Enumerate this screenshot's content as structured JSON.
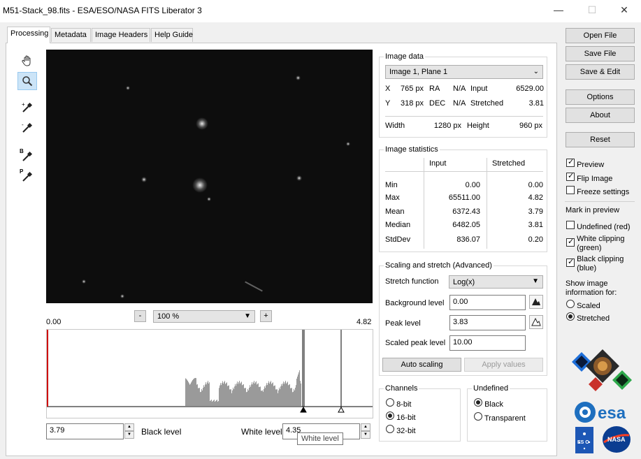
{
  "window": {
    "title": "M51-Stack_98.fits - ESA/ESO/NASA FITS Liberator 3",
    "minimize": "—",
    "maximize": "☐",
    "close": "✕"
  },
  "tabs": [
    "Processing",
    "Metadata",
    "Image Headers",
    "Help Guide"
  ],
  "tools": {
    "hand": "hand-tool",
    "zoom": "zoom-tool",
    "picker_plus": "picker-add-tool",
    "picker_minus": "picker-remove-tool",
    "black_picker_letter": "B",
    "peak_picker_letter": "P"
  },
  "viewer": {
    "zoom_minus": "-",
    "zoom_value": "100 %",
    "zoom_plus": "+",
    "hist_min": "0.00",
    "hist_max": "4.82"
  },
  "levels": {
    "black_value": "3.79",
    "black_label": "Black level",
    "white_label": "White level",
    "white_value": "4.35",
    "tooltip": "White level"
  },
  "image_data": {
    "title": "Image data",
    "plane": "Image 1, Plane 1",
    "x_label": "X",
    "x_value": "765 px",
    "ra_label": "RA",
    "ra_value": "N/A",
    "input_label": "Input",
    "input_value": "6529.00",
    "y_label": "Y",
    "y_value": "318 px",
    "dec_label": "DEC",
    "dec_value": "N/A",
    "stretched_label": "Stretched",
    "stretched_value": "3.81",
    "width_label": "Width",
    "width_value": "1280 px",
    "height_label": "Height",
    "height_value": "960 px"
  },
  "stats": {
    "title": "Image statistics",
    "col_input": "Input",
    "col_stretched": "Stretched",
    "rows": [
      {
        "label": "Min",
        "input": "0.00",
        "stretched": "0.00"
      },
      {
        "label": "Max",
        "input": "65511.00",
        "stretched": "4.82"
      },
      {
        "label": "Mean",
        "input": "6372.43",
        "stretched": "3.79"
      },
      {
        "label": "Median",
        "input": "6482.05",
        "stretched": "3.81"
      },
      {
        "label": "StdDev",
        "input": "836.07",
        "stretched": "0.20"
      }
    ]
  },
  "scaling": {
    "title": "Scaling and stretch (Advanced)",
    "stretch_label": "Stretch function",
    "stretch_value": "Log(x)",
    "background_label": "Background level",
    "background_value": "0.00",
    "peak_label": "Peak level",
    "peak_value": "3.83",
    "scaled_peak_label": "Scaled peak level",
    "scaled_peak_value": "10.00",
    "auto_btn": "Auto scaling",
    "apply_btn": "Apply values"
  },
  "channels": {
    "title": "Channels",
    "options": [
      "8-bit",
      "16-bit",
      "32-bit"
    ],
    "selected": "16-bit"
  },
  "undefined": {
    "title": "Undefined",
    "options": [
      "Black",
      "Transparent"
    ],
    "selected": "Black"
  },
  "sidebar": {
    "open_file": "Open File",
    "save_file": "Save File",
    "save_edit": "Save & Edit",
    "options": "Options",
    "about": "About",
    "reset": "Reset",
    "preview": "Preview",
    "flip": "Flip Image",
    "freeze": "Freeze settings",
    "mark_title": "Mark in preview",
    "undefined_red": "Undefined (red)",
    "white_clip_1": "White clipping",
    "white_clip_2": "(green)",
    "black_clip_1": "Black clipping",
    "black_clip_2": "(blue)",
    "show_info_1": "Show image",
    "show_info_2": "information for:",
    "scaled": "Scaled",
    "stretched": "Stretched",
    "esa_text": "esa",
    "eso_text": "ES O",
    "nasa_text": "NASA"
  },
  "colors": {
    "histogram_bar": "#9a9a9a",
    "accent_selected": "#cce4f7",
    "clip_red": "#d00000"
  }
}
